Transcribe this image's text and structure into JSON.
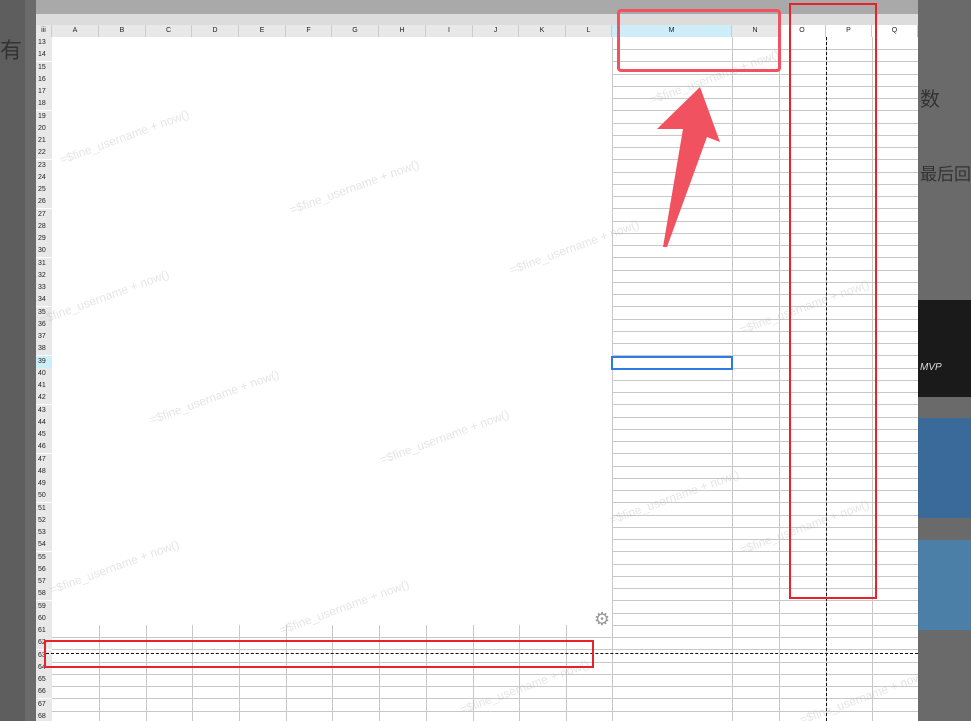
{
  "background": {
    "left_text": "有",
    "right_texts": [
      "数",
      "最后回"
    ],
    "banner_text": "MVP"
  },
  "sheet": {
    "corner": "iii",
    "columns": [
      "A",
      "B",
      "C",
      "D",
      "E",
      "F",
      "G",
      "H",
      "I",
      "J",
      "K",
      "L",
      "M",
      "N",
      "O",
      "P",
      "Q"
    ],
    "selected_column": "M",
    "first_row": 13,
    "last_row": 68,
    "selected_row": 39,
    "merged_area": "A13:L60",
    "selected_cell": "M39",
    "watermark": "=$fine_username + now()"
  },
  "annotations": {
    "color": "#e8222a",
    "arrow_color": "#f0525f"
  }
}
